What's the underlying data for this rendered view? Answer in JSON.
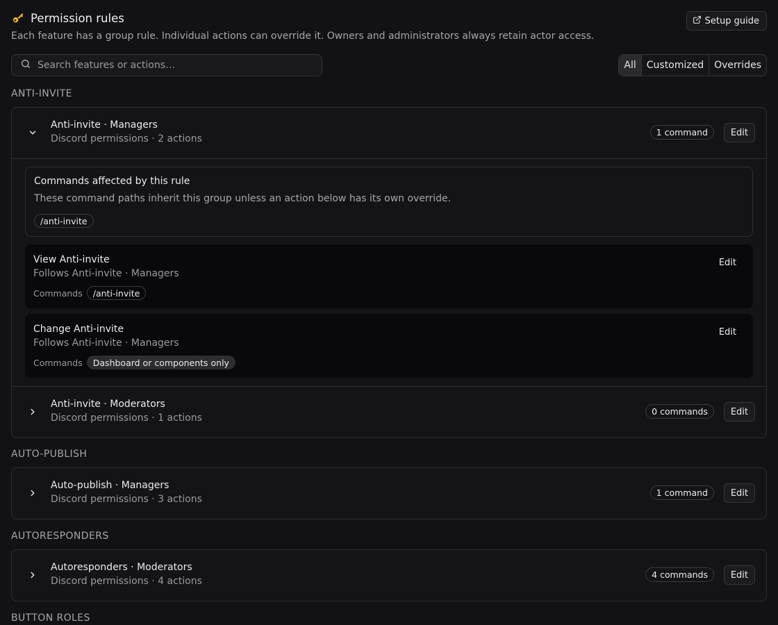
{
  "header": {
    "title": "Permission rules",
    "subtitle": "Each feature has a group rule. Individual actions can override it. Owners and administrators always retain actor access.",
    "setup_guide": "Setup guide"
  },
  "search": {
    "placeholder": "Search features or actions…",
    "value": ""
  },
  "filters": {
    "all": "All",
    "customized": "Customized",
    "overrides": "Overrides",
    "selected": "All"
  },
  "sections": {
    "anti_invite": {
      "label": "ANTI-INVITE",
      "groups": [
        {
          "title": "Anti-invite · Managers",
          "subtitle": "Discord permissions · 2 actions",
          "commands_badge": "1 command",
          "edit": "Edit",
          "expanded": true,
          "affected": {
            "title": "Commands affected by this rule",
            "description": "These command paths inherit this group unless an action below has its own override.",
            "command": "/anti-invite"
          },
          "actions": [
            {
              "title": "View Anti-invite",
              "subtitle": "Follows Anti-invite · Managers",
              "commands_label": "Commands",
              "command": "/anti-invite",
              "edit": "Edit"
            },
            {
              "title": "Change Anti-invite",
              "subtitle": "Follows Anti-invite · Managers",
              "commands_label": "Commands",
              "command": "Dashboard or components only",
              "edit": "Edit"
            }
          ]
        },
        {
          "title": "Anti-invite · Moderators",
          "subtitle": "Discord permissions · 1 actions",
          "commands_badge": "0 commands",
          "edit": "Edit",
          "expanded": false
        }
      ]
    },
    "auto_publish": {
      "label": "AUTO-PUBLISH",
      "groups": [
        {
          "title": "Auto-publish · Managers",
          "subtitle": "Discord permissions · 3 actions",
          "commands_badge": "1 command",
          "edit": "Edit",
          "expanded": false
        }
      ]
    },
    "autoresponders": {
      "label": "AUTORESPONDERS",
      "groups": [
        {
          "title": "Autoresponders · Moderators",
          "subtitle": "Discord permissions · 4 actions",
          "commands_badge": "4 commands",
          "edit": "Edit",
          "expanded": false
        }
      ]
    },
    "button_roles": {
      "label": "BUTTON ROLES"
    }
  },
  "icons": {
    "key": "key-icon",
    "external": "external-link-icon",
    "search": "search-icon",
    "chevron_down": "chevron-down-icon",
    "chevron_right": "chevron-right-icon"
  },
  "colors": {
    "background": "#121214",
    "card": "#141417",
    "action_card": "#09090b",
    "border": "#2e2e33"
  }
}
